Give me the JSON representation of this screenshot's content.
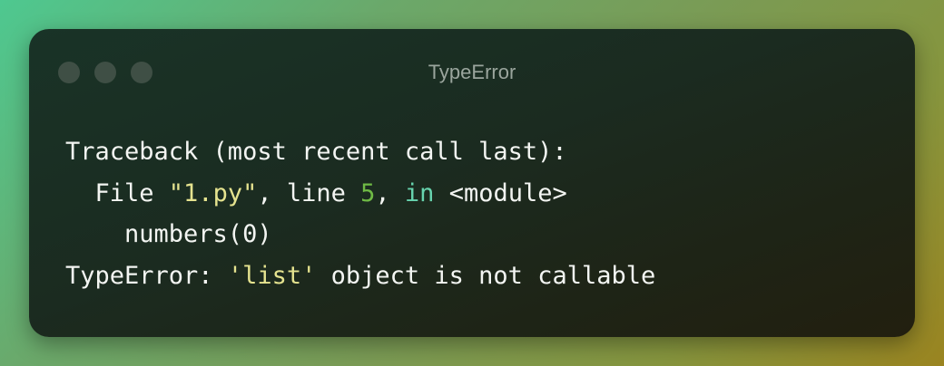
{
  "window": {
    "title": "TypeError",
    "controls": [
      "close-dot",
      "minimize-dot",
      "maximize-dot"
    ]
  },
  "traceback": {
    "header": "Traceback (most recent call last):",
    "file_prefix": "  File ",
    "file_name": "\"1.py\"",
    "line_text": ", line ",
    "line_number": "5",
    "comma": ", ",
    "in_keyword": "in",
    "module": " <module>",
    "code_line": "    numbers(0)",
    "error_type": "TypeError: ",
    "error_object": "'list'",
    "error_message": " object is not callable"
  },
  "colors": {
    "string": "#e5e38f",
    "number": "#6fba45",
    "keyword": "#67d3ae",
    "text": "#f3f5f2"
  }
}
